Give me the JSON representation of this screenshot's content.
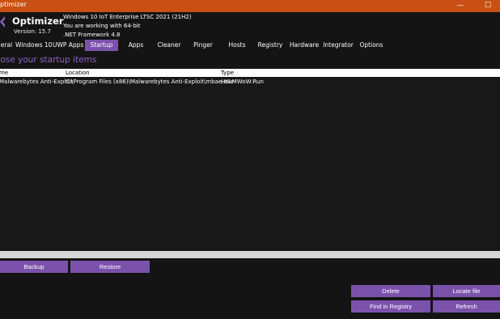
{
  "window": {
    "title": "ptimizer",
    "minimize": "—",
    "maximize": "☐"
  },
  "app": {
    "name": "Optimizer",
    "version": "Version: 15.7"
  },
  "sysinfo": [
    "Windows 10 IoT Enterprise LTSC 2021 (21H2)",
    "You are working with 64-bit",
    ".NET Framework 4.8"
  ],
  "tabs": [
    "eral",
    "Windows 10",
    "UWP Apps",
    "Startup",
    "Apps",
    "Cleaner",
    "Pinger",
    "Hosts",
    "Registry",
    "Hardware",
    "Integrator",
    "Options"
  ],
  "active_tab": "Startup",
  "section_title": "oose your startup items",
  "table": {
    "columns": [
      "me",
      "Location",
      "Type"
    ],
    "rows": [
      [
        "Malwarebytes Anti-Exploit",
        "C:\\Program Files (x86)\\Malwarebytes Anti-Exploit\\mbae.exe",
        "HKLMWoW:Run"
      ]
    ]
  },
  "buttons": {
    "backup": "Backup",
    "restore": "Restore",
    "delete": "Delete",
    "locate_file": "Locate file",
    "find_in_registry": "Find in Registry",
    "refresh": "Refresh"
  },
  "colors": {
    "accent": "#7b52ab",
    "titlebar": "#c85014",
    "background": "#141414",
    "section_title": "#8c64c3"
  }
}
